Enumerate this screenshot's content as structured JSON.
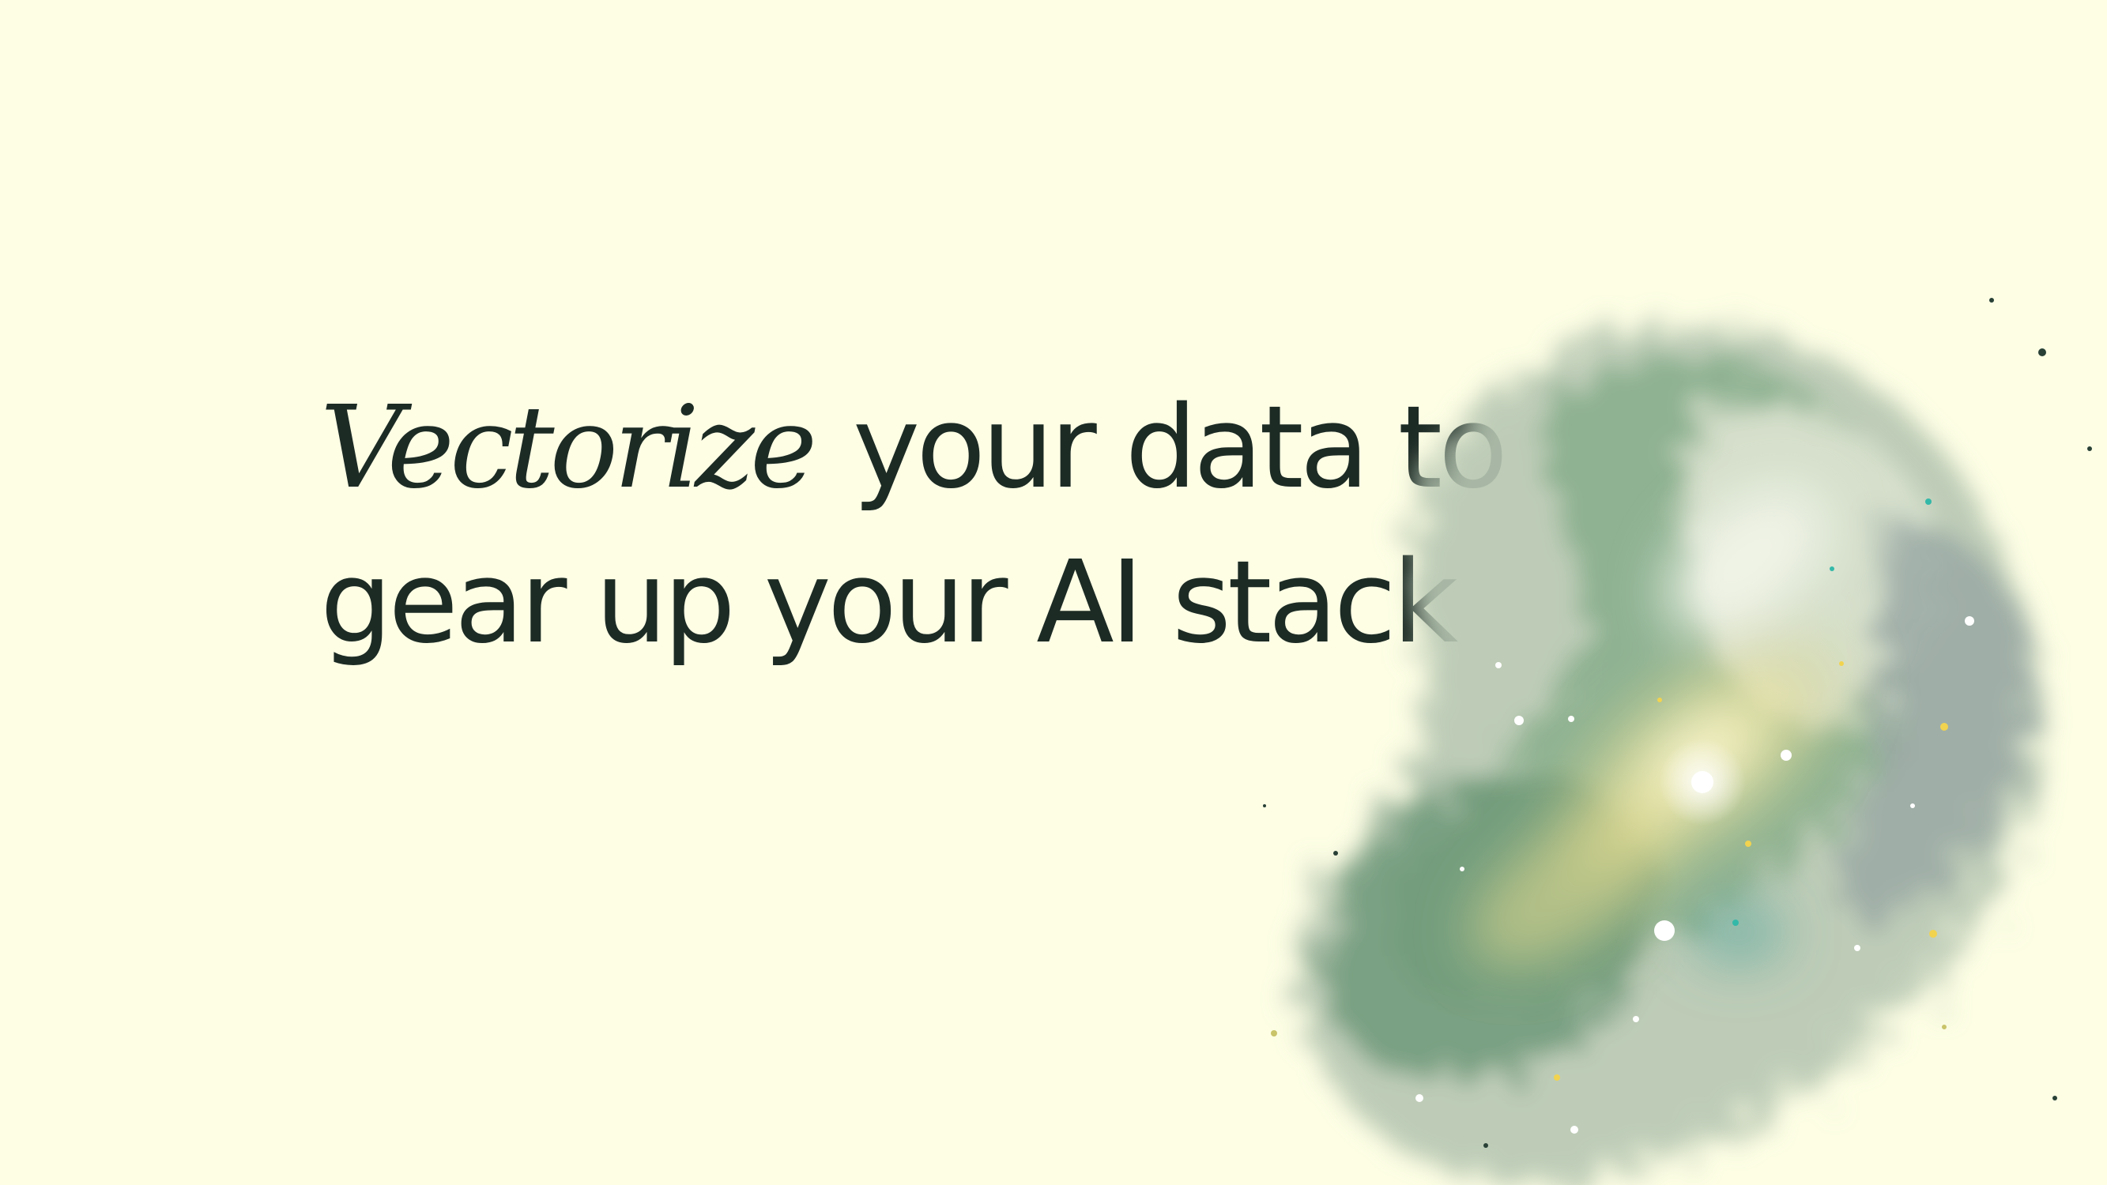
{
  "hero": {
    "headline_emphasis": "Vectorize",
    "headline_line1_rest": " your data to",
    "headline_line2": "gear up your AI stack"
  },
  "colors": {
    "background": "#fdfee4",
    "text": "#1d2b25",
    "nebula_green": "#6f9a7a",
    "nebula_gold": "#e9df8f"
  },
  "icons": {
    "hero_art": "nebula-illustration"
  }
}
